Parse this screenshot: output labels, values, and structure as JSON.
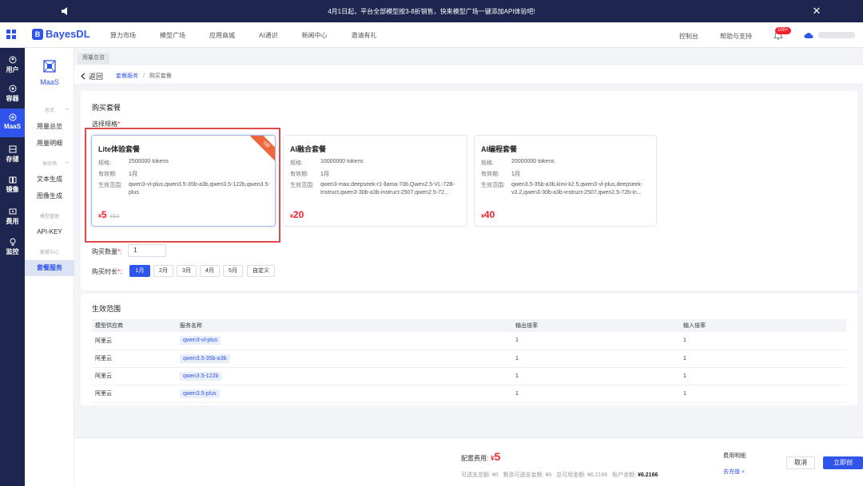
{
  "announcement": {
    "text": "4月1日起，平台全部模型按3-8折销售，快来模型广场一键添加API体验吧!"
  },
  "header": {
    "logo": "BayesDL",
    "nav": [
      "算力市场",
      "模型广场",
      "应用商城",
      "AI通识",
      "新闻中心",
      "邀请有礼"
    ],
    "console": "控制台",
    "help": "帮助与支持",
    "badge": "100+"
  },
  "rail": [
    {
      "label": "用户",
      "icon": "user-icon"
    },
    {
      "label": "容器",
      "icon": "container-icon"
    },
    {
      "label": "MaaS",
      "icon": "maas-icon",
      "active": true
    },
    {
      "label": "存储",
      "icon": "storage-icon"
    },
    {
      "label": "镜像",
      "icon": "image-icon"
    },
    {
      "label": "费用",
      "icon": "billing-icon"
    },
    {
      "label": "监控",
      "icon": "monitor-icon"
    }
  ],
  "subnav": {
    "title": "MaaS",
    "groups": [
      "总览",
      "体验场",
      "模型管理",
      "套餐中心"
    ],
    "items": [
      "用量总览",
      "用量明细",
      "文本生成",
      "图像生成",
      "API-KEY",
      "套餐服务"
    ]
  },
  "tab": "用量总览",
  "breadcrumb": {
    "back": "返回",
    "parent": "套餐服务",
    "sep": "/",
    "current": "购买套餐"
  },
  "purchase": {
    "title": "购买套餐",
    "spec_label": "选择规格",
    "star": "*",
    "field_labels": {
      "spec": "规格:",
      "validity": "有效期:",
      "scope": "生效范围:"
    },
    "packages": [
      {
        "name": "Lite体验套餐",
        "spec": "2500000 tokens",
        "validity": "1月",
        "scope": "qwen3-vl-plus,qwen3.5-35b-a3b,qwen3.5-122b,qwen3.5-plus",
        "currency": "¥",
        "price": "5",
        "original": "¥10",
        "ribbon": "5折",
        "selected": true
      },
      {
        "name": "AI融合套餐",
        "spec": "10000000 tokens",
        "validity": "1月",
        "scope": "qwen3-max,deepseek-r1-llama-70b,Qwen2.5-VL-72B-Instruct,qwen3-30b-a3b-instruct-2507,qwen2.5-72...",
        "currency": "¥",
        "price": "20"
      },
      {
        "name": "AI编程套餐",
        "spec": "20000000 tokens",
        "validity": "1月",
        "scope": "qwen3.5-35b-a3b,kimi-k2.5,qwen3-vl-plus,deepseek-v3.2,qwen3-30b-a3b-instruct-2507,qwen2.5-72b-in...",
        "currency": "¥",
        "price": "40"
      }
    ],
    "qty_label": "购买数量",
    "qty_value": "1",
    "duration_label": "购买时长",
    "durations": [
      "1月",
      "2月",
      "3月",
      "4月",
      "5月",
      "自定义"
    ],
    "duration_selected": 0
  },
  "scope_table": {
    "title": "生效范围",
    "headers": [
      "模型供应商",
      "服务名称",
      "输出倍率",
      "输入倍率"
    ],
    "rows": [
      [
        "阿里云",
        "qwen3-vl-plus",
        "1",
        "1"
      ],
      [
        "阿里云",
        "qwen3.5-35b-a3b",
        "1",
        "1"
      ],
      [
        "阿里云",
        "qwen3.5-122b",
        "1",
        "1"
      ],
      [
        "阿里云",
        "qwen3.5-plus",
        "1",
        "1"
      ]
    ]
  },
  "footer": {
    "cost_label": "配置费用:",
    "currency": "¥",
    "cost": "5",
    "stats": {
      "l1": "可透支总额:",
      "v1": "¥0",
      "l2": "剩余可透支金额:",
      "v2": "¥0",
      "l3": "总可用金额:",
      "v3": "¥6.2166",
      "l4": "账户余额:",
      "v4": "¥6.2166"
    },
    "detail": "费用明细",
    "recharge": "去充值 »",
    "cancel": "取消",
    "create": "立即创建"
  },
  "colors": {
    "accent": "#2f54eb",
    "nav_dark": "#1e2650",
    "price_red": "#f5222d",
    "highlight": "#e04a4a",
    "ribbon": "#f0663c"
  }
}
